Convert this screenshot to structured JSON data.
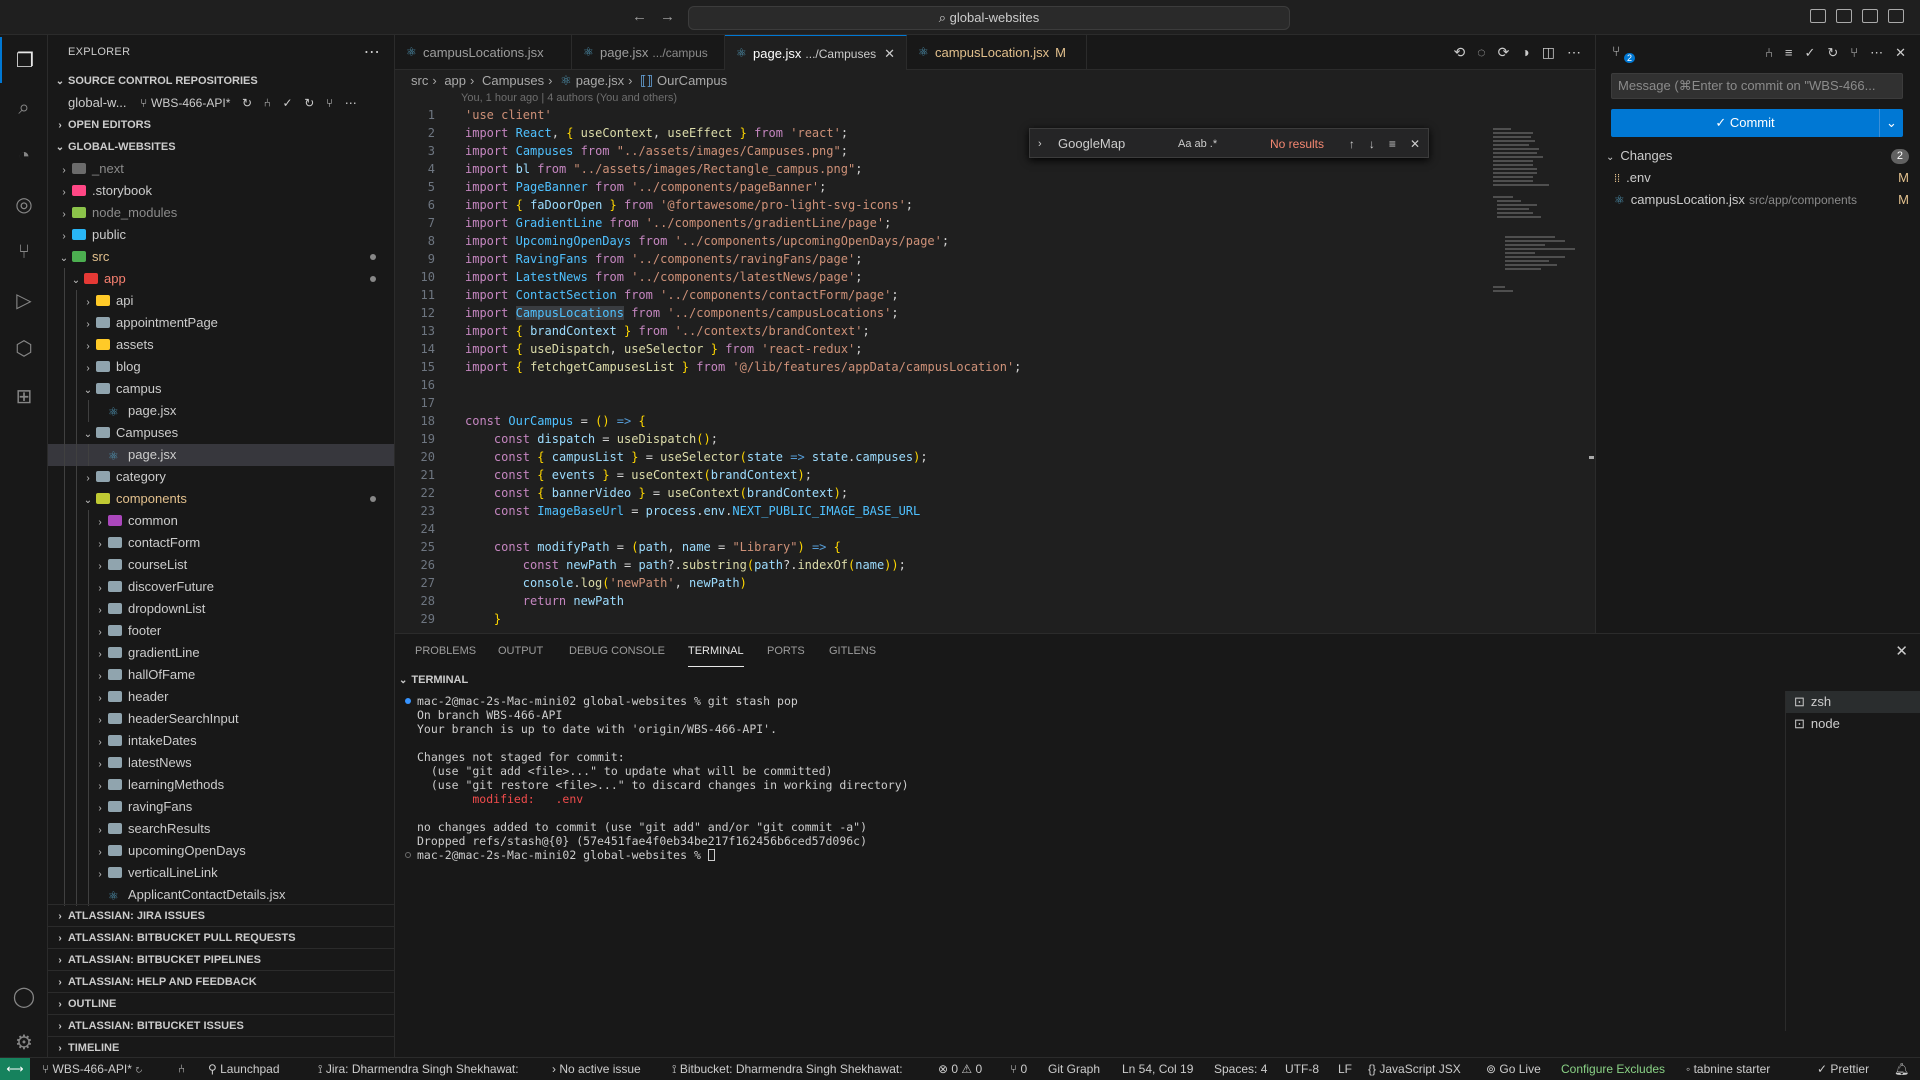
{
  "window": {
    "search": "global-websites"
  },
  "explorer": {
    "title": "EXPLORER",
    "source_control_repos": "SOURCE CONTROL REPOSITORIES",
    "repo_name": "global-w...",
    "repo_branch": "WBS-466-API*",
    "open_editors": "OPEN EDITORS",
    "project": "GLOBAL-WEBSITES",
    "tree": [
      {
        "label": "_next",
        "depth": 1,
        "open": false,
        "kind": "dir"
      },
      {
        "label": ".storybook",
        "depth": 1,
        "open": false,
        "kind": "dir"
      },
      {
        "label": "node_modules",
        "depth": 1,
        "open": false,
        "kind": "dir"
      },
      {
        "label": "public",
        "depth": 1,
        "open": false,
        "kind": "dir"
      },
      {
        "label": "src",
        "depth": 1,
        "open": true,
        "kind": "dir"
      },
      {
        "label": "app",
        "depth": 2,
        "open": true,
        "kind": "dir"
      },
      {
        "label": "api",
        "depth": 3,
        "open": false,
        "kind": "dir"
      },
      {
        "label": "appointmentPage",
        "depth": 3,
        "open": false,
        "kind": "dir"
      },
      {
        "label": "assets",
        "depth": 3,
        "open": false,
        "kind": "dir"
      },
      {
        "label": "blog",
        "depth": 3,
        "open": false,
        "kind": "dir"
      },
      {
        "label": "campus",
        "depth": 3,
        "open": true,
        "kind": "dir"
      },
      {
        "label": "page.jsx",
        "depth": 4,
        "kind": "file"
      },
      {
        "label": "Campuses",
        "depth": 3,
        "open": true,
        "kind": "dir"
      },
      {
        "label": "page.jsx",
        "depth": 4,
        "kind": "file"
      },
      {
        "label": "category",
        "depth": 3,
        "open": false,
        "kind": "dir"
      },
      {
        "label": "components",
        "depth": 3,
        "open": true,
        "kind": "dir"
      },
      {
        "label": "common",
        "depth": 4,
        "open": false,
        "kind": "dir"
      },
      {
        "label": "contactForm",
        "depth": 4,
        "open": false,
        "kind": "dir"
      },
      {
        "label": "courseList",
        "depth": 4,
        "open": false,
        "kind": "dir"
      },
      {
        "label": "discoverFuture",
        "depth": 4,
        "open": false,
        "kind": "dir"
      },
      {
        "label": "dropdownList",
        "depth": 4,
        "open": false,
        "kind": "dir"
      },
      {
        "label": "footer",
        "depth": 4,
        "open": false,
        "kind": "dir"
      },
      {
        "label": "gradientLine",
        "depth": 4,
        "open": false,
        "kind": "dir"
      },
      {
        "label": "hallOfFame",
        "depth": 4,
        "open": false,
        "kind": "dir"
      },
      {
        "label": "header",
        "depth": 4,
        "open": false,
        "kind": "dir"
      },
      {
        "label": "headerSearchInput",
        "depth": 4,
        "open": false,
        "kind": "dir"
      },
      {
        "label": "intakeDates",
        "depth": 4,
        "open": false,
        "kind": "dir"
      },
      {
        "label": "latestNews",
        "depth": 4,
        "open": false,
        "kind": "dir"
      },
      {
        "label": "learningMethods",
        "depth": 4,
        "open": false,
        "kind": "dir"
      },
      {
        "label": "ravingFans",
        "depth": 4,
        "open": false,
        "kind": "dir"
      },
      {
        "label": "searchResults",
        "depth": 4,
        "open": false,
        "kind": "dir"
      },
      {
        "label": "upcomingOpenDays",
        "depth": 4,
        "open": false,
        "kind": "dir"
      },
      {
        "label": "verticalLineLink",
        "depth": 4,
        "open": false,
        "kind": "dir"
      },
      {
        "label": "ApplicantContactDetails.jsx",
        "depth": 4,
        "kind": "file"
      }
    ],
    "bottom_sections": [
      "ATLASSIAN: JIRA ISSUES",
      "ATLASSIAN: BITBUCKET PULL REQUESTS",
      "ATLASSIAN: BITBUCKET PIPELINES",
      "ATLASSIAN: HELP AND FEEDBACK",
      "OUTLINE",
      "ATLASSIAN: BITBUCKET ISSUES",
      "TIMELINE"
    ]
  },
  "tabs": [
    {
      "label": "campusLocations.jsx",
      "desc": ""
    },
    {
      "label": "page.jsx",
      "desc": ".../campus"
    },
    {
      "label": "page.jsx",
      "desc": ".../Campuses"
    },
    {
      "label": "campusLocation.jsx",
      "desc": "",
      "badge": "M"
    }
  ],
  "breadcrumbs": [
    "src",
    "app",
    "Campuses",
    "page.jsx",
    "OurCampus"
  ],
  "blame": "You, 1 hour ago | 4 authors (You and others)",
  "find": {
    "query": "GoogleMap",
    "result": "No results",
    "opts": "Aa  ab  .*"
  },
  "code_lines": [
    "'use client'",
    "import React, { useContext, useEffect } from 'react';",
    "import Campuses from \"../assets/images/Campuses.png\";",
    "import bl from \"../assets/images/Rectangle_campus.png\";",
    "import PageBanner from '../components/pageBanner';",
    "import { faDoorOpen } from '@fortawesome/pro-light-svg-icons';",
    "import GradientLine from '../components/gradientLine/page';",
    "import UpcomingOpenDays from '../components/upcomingOpenDays/page';",
    "import RavingFans from '../components/ravingFans/page';",
    "import LatestNews from '../components/latestNews/page';",
    "import ContactSection from '../components/contactForm/page';",
    "import CampusLocations from '../components/campusLocations';",
    "import { brandContext } from '../contexts/brandContext';",
    "import { useDispatch, useSelector } from 'react-redux';",
    "import { fetchgetCampusesList } from '@/lib/features/appData/campusLocation';",
    "",
    "",
    "const OurCampus = () => {",
    "    const dispatch = useDispatch();",
    "    const { campusList } = useSelector(state => state.campuses);",
    "    const { events } = useContext(brandContext);",
    "    const { bannerVideo } = useContext(brandContext);",
    "    const ImageBaseUrl = process.env.NEXT_PUBLIC_IMAGE_BASE_URL",
    "",
    "    const modifyPath = (path, name = \"Library\") => {",
    "        const newPath = path?.substring(path?.indexOf(name));",
    "        console.log('newPath', newPath)",
    "        return newPath",
    "    }"
  ],
  "panel": {
    "tabs": [
      "PROBLEMS",
      "OUTPUT",
      "DEBUG CONSOLE",
      "TERMINAL",
      "PORTS",
      "GITLENS"
    ],
    "active": "TERMINAL",
    "terminal_header": "TERMINAL",
    "terminal_lines": [
      "mac-2@mac-2s-Mac-mini02 global-websites % git stash pop",
      "On branch WBS-466-API",
      "Your branch is up to date with 'origin/WBS-466-API'.",
      "",
      "Changes not staged for commit:",
      "  (use \"git add <file>...\" to update what will be committed)",
      "  (use \"git restore <file>...\" to discard changes in working directory)",
      "        modified:   .env",
      "",
      "no changes added to commit (use \"git add\" and/or \"git commit -a\")",
      "Dropped refs/stash@{0} (57e451fae4f0eb34be217f162456b6ced57d096c)",
      "mac-2@mac-2s-Mac-mini02 global-websites % "
    ],
    "terminals": [
      "zsh",
      "node"
    ]
  },
  "scm": {
    "badge": "2",
    "message_placeholder": "Message (⌘Enter to commit on \"WBS-466...",
    "commit_label": "✓ Commit",
    "changes_label": "Changes",
    "changes_count": "2",
    "changes": [
      {
        "name": ".env",
        "path": "",
        "status": "M"
      },
      {
        "name": "campusLocation.jsx",
        "path": "src/app/components",
        "status": "M"
      }
    ]
  },
  "status": {
    "branch": "WBS-466-API*",
    "launchpad": "Launchpad",
    "jira": "Jira: Dharmendra Singh Shekhawat:",
    "issue": "No active issue",
    "bitbucket": "Bitbucket: Dharmendra Singh Shekhawat:",
    "problems": "⊗ 0 ⚠ 0",
    "ports": "⑂ 0",
    "gitgraph": "Git Graph",
    "position": "Ln 54, Col 19",
    "spaces": "Spaces: 4",
    "encoding": "UTF-8",
    "eol": "LF",
    "language": "JavaScript JSX",
    "golive": "Go Live",
    "excludes": "Configure Excludes",
    "tabnine": "tabnine starter",
    "prettier": "Prettier"
  },
  "colors": {
    "accent": "#0078d4",
    "modified": "#e2c08d",
    "remote": "#16825d"
  }
}
